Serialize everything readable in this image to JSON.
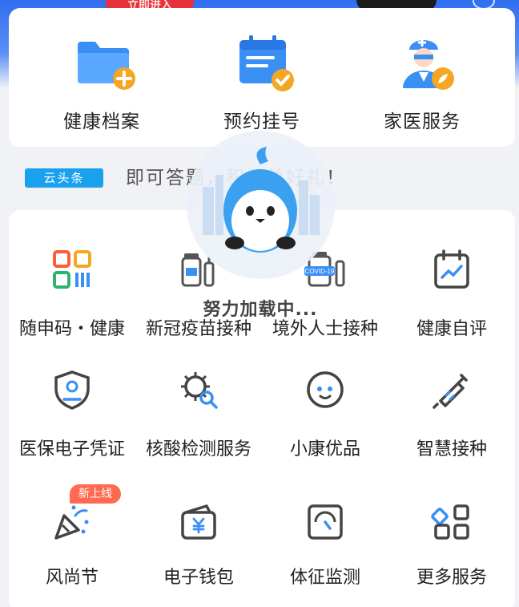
{
  "banner": {
    "pill_text": "立即进入"
  },
  "top_services": [
    {
      "label": "健康档案",
      "icon": "folder-plus-icon"
    },
    {
      "label": "预约挂号",
      "icon": "calendar-check-icon"
    },
    {
      "label": "家医服务",
      "icon": "doctor-icon"
    }
  ],
  "news": {
    "tag": "云头条",
    "text": "即可答题，积分兑好礼！"
  },
  "grid_services": [
    {
      "label": "随申码・健康",
      "icon": "qr-code-icon"
    },
    {
      "label": "新冠疫苗接种",
      "icon": "vaccine-bottle-icon"
    },
    {
      "label": "境外人士接种",
      "icon": "covid19-vaccine-icon"
    },
    {
      "label": "健康自评",
      "icon": "calendar-chart-icon"
    },
    {
      "label": "医保电子凭证",
      "icon": "shield-person-icon"
    },
    {
      "label": "核酸检测服务",
      "icon": "virus-search-icon"
    },
    {
      "label": "小康优品",
      "icon": "mascot-face-icon"
    },
    {
      "label": "智慧接种",
      "icon": "syringe-icon"
    },
    {
      "label": "风尚节",
      "icon": "party-popper-icon"
    },
    {
      "label": "电子钱包",
      "icon": "wallet-yen-icon"
    },
    {
      "label": "体征监测",
      "icon": "gauge-icon"
    },
    {
      "label": "更多服务",
      "icon": "more-grid-icon"
    }
  ],
  "badges": {
    "new_online": "新上线"
  },
  "loading": {
    "text": "努力加载中..."
  },
  "colors": {
    "accent_blue": "#1a8cf0",
    "accent_orange": "#f5a623",
    "badge_red": "#ff6a50",
    "tag_blue": "#1aa1ee"
  }
}
